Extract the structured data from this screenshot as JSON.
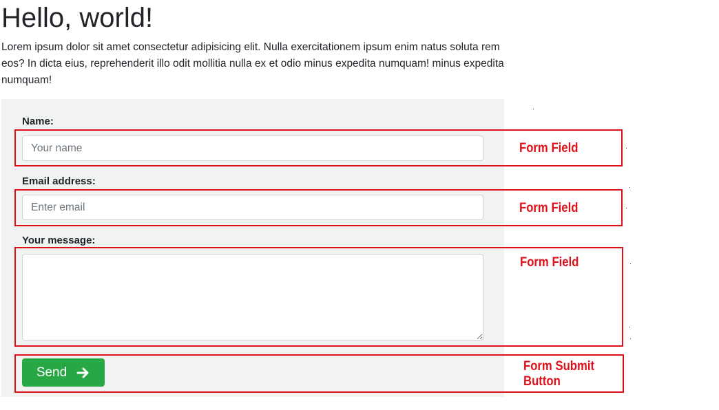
{
  "page": {
    "title": "Hello, world!",
    "lead": "Lorem ipsum dolor sit amet consectetur adipisicing elit. Nulla exercitationem ipsum enim natus soluta rem eos? In dicta eius, reprehenderit illo odit mollitia nulla ex et odio minus expedita numquam! minus expedita numquam!"
  },
  "form": {
    "name_label": "Name:",
    "name_placeholder": "Your name",
    "name_value": "",
    "email_label": "Email address:",
    "email_placeholder": "Enter email",
    "email_value": "",
    "message_label": "Your message:",
    "message_value": "",
    "send_label": "Send",
    "send_icon": "arrow-right-icon",
    "send_color": "#28a745"
  },
  "annotations": {
    "color": "#e0101a",
    "name_field": "Form Field",
    "email_field": "Form Field",
    "message_field": "Form Field",
    "submit_line1": "Form Submit",
    "submit_line2": "Button"
  }
}
